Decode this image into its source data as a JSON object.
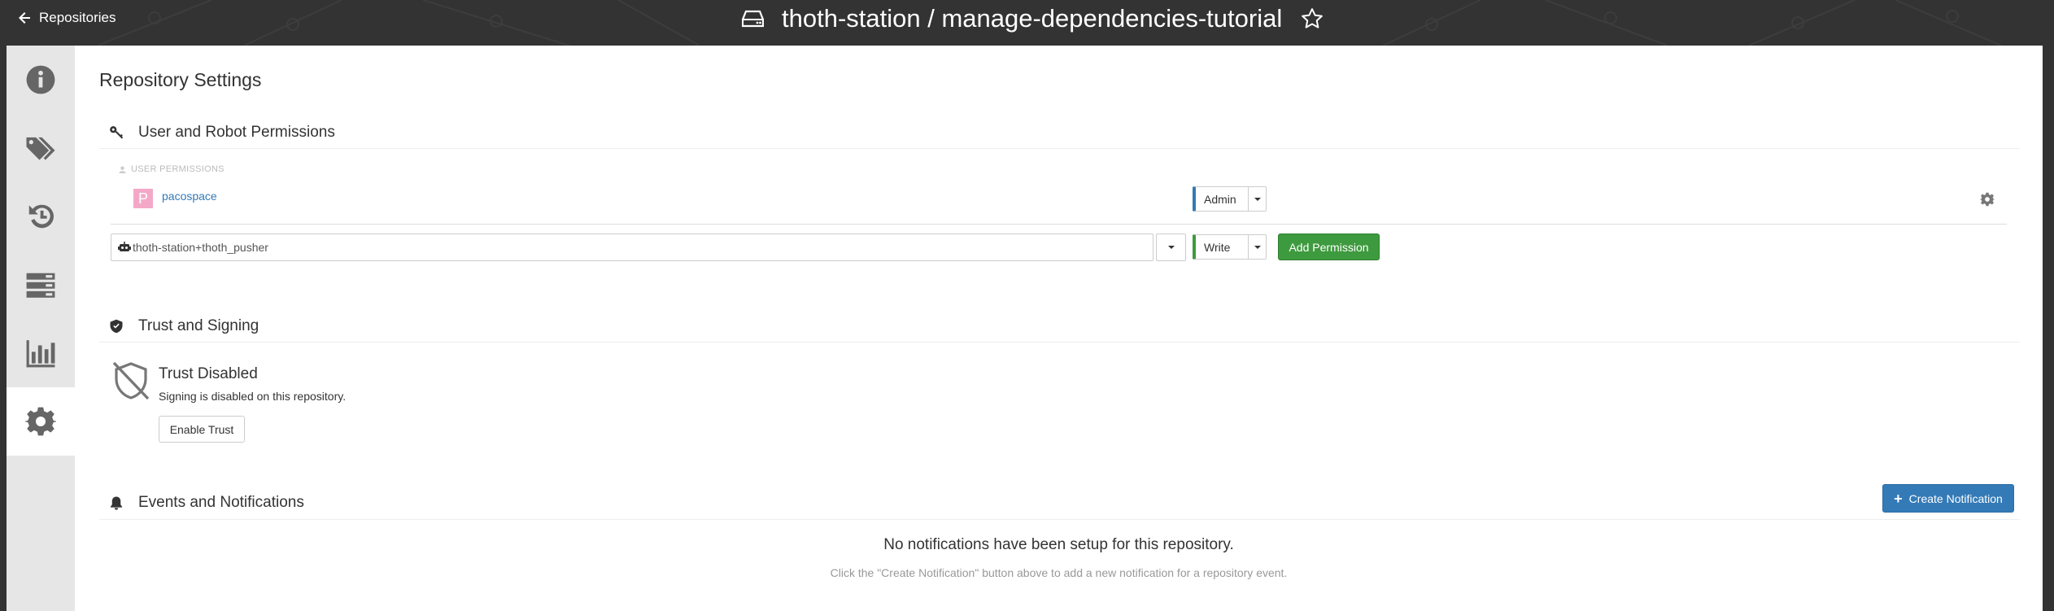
{
  "header": {
    "back_label": "Repositories",
    "repo_name": "thoth-station / manage-dependencies-tutorial"
  },
  "sidebar": {
    "items": [
      {
        "icon": "info-icon",
        "active": false
      },
      {
        "icon": "tags-icon",
        "active": false
      },
      {
        "icon": "history-icon",
        "active": false
      },
      {
        "icon": "builds-icon",
        "active": false
      },
      {
        "icon": "usage-logs-icon",
        "active": false
      },
      {
        "icon": "settings-gear-icon",
        "active": true
      }
    ]
  },
  "page": {
    "title": "Repository Settings"
  },
  "permissions": {
    "section_title": "User and Robot Permissions",
    "user_subheader": "USER PERMISSIONS",
    "users": [
      {
        "avatar_letter": "P",
        "name": "pacospace",
        "role": "Admin"
      }
    ],
    "new_entity_value": "thoth-station+thoth_pusher",
    "new_role": "Write",
    "add_button": "Add Permission"
  },
  "trust": {
    "section_title": "Trust and Signing",
    "status_title": "Trust Disabled",
    "status_desc": "Signing is disabled on this repository.",
    "enable_button": "Enable Trust"
  },
  "notifications": {
    "section_title": "Events and Notifications",
    "create_button": "Create Notification",
    "empty_title": "No notifications have been setup for this repository.",
    "empty_desc": "Click the \"Create Notification\" button above to add a new notification for a repository event."
  },
  "colors": {
    "topbar": "#333333",
    "sidebar": "#e6e6e6",
    "link": "#337ab7",
    "admin_role": "#337ab7",
    "write_role": "#3e9a3e",
    "success_button": "#3e9a3e",
    "primary_button": "#337ab7",
    "avatar_bg": "#f4a8c8"
  }
}
